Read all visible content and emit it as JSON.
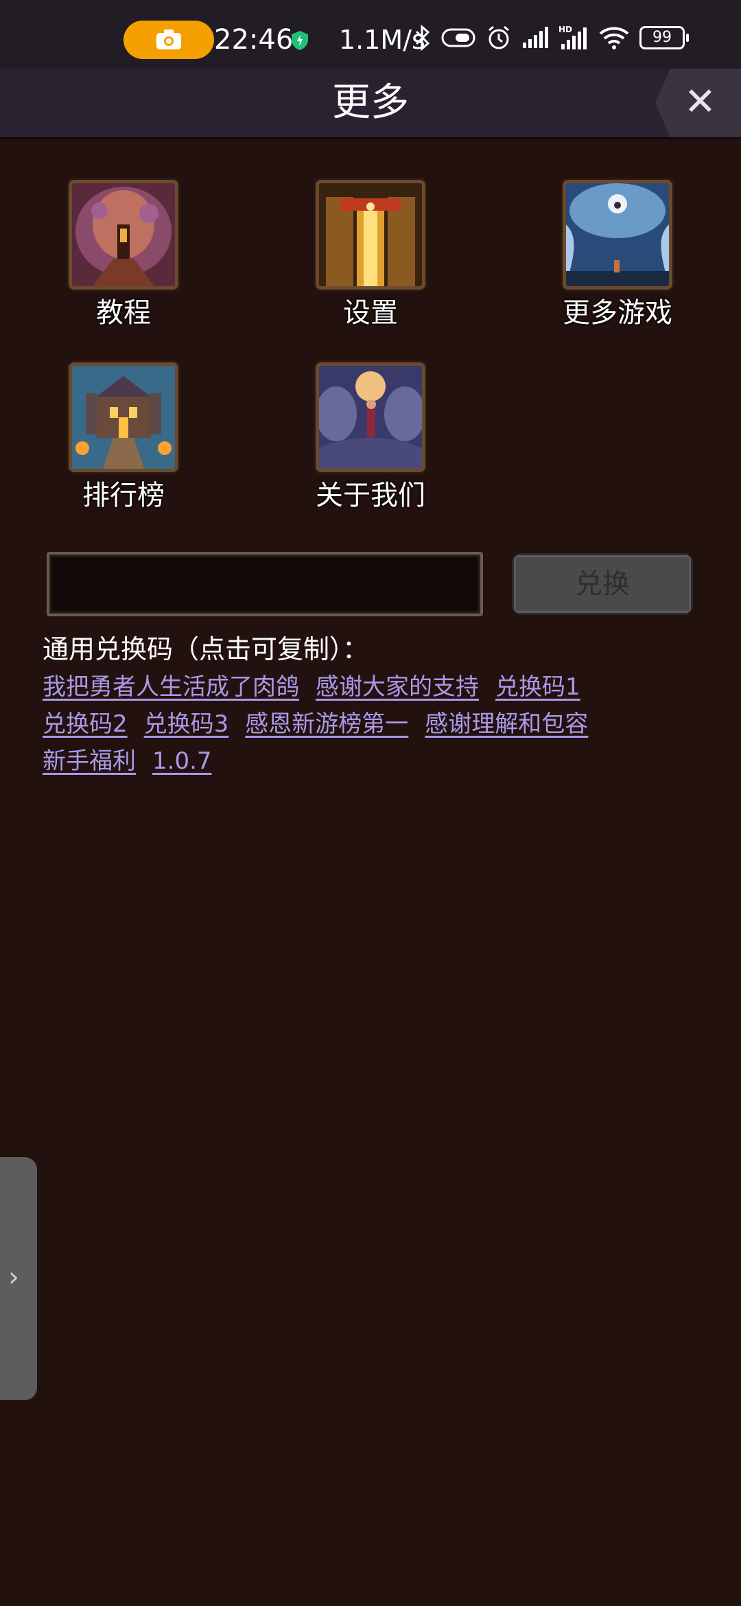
{
  "status_bar": {
    "time": "22:46",
    "net_speed": "1.1M/s",
    "battery": "99",
    "icons": [
      "camera-icon",
      "shield-icon",
      "bluetooth-icon",
      "vibrate-icon",
      "alarm-icon",
      "signal-icon",
      "hd-signal-icon",
      "wifi-icon",
      "battery-icon"
    ]
  },
  "header": {
    "title": "更多",
    "close_label": "✕"
  },
  "menu": [
    {
      "label": "教程",
      "icon": "tutorial-icon"
    },
    {
      "label": "设置",
      "icon": "settings-icon"
    },
    {
      "label": "更多游戏",
      "icon": "more-games-icon"
    },
    {
      "label": "排行榜",
      "icon": "leaderboard-icon"
    },
    {
      "label": "关于我们",
      "icon": "about-icon"
    }
  ],
  "redeem": {
    "input_value": "",
    "input_placeholder": "",
    "button_label": "兑换"
  },
  "codes": {
    "title": "通用兑换码（点击可复制）：",
    "items": [
      "我把勇者人生活成了肉鸽",
      "感谢大家的支持",
      "兑换码1",
      "兑换码2",
      "兑换码3",
      "感恩新游榜第一",
      "感谢理解和包容",
      "新手福利",
      "1.0.7"
    ]
  },
  "side_tab": {
    "label": "›"
  },
  "colors": {
    "background": "#22110f",
    "header": "#2a2230",
    "link": "#a99ae8",
    "accent_pill": "#f5a000"
  }
}
